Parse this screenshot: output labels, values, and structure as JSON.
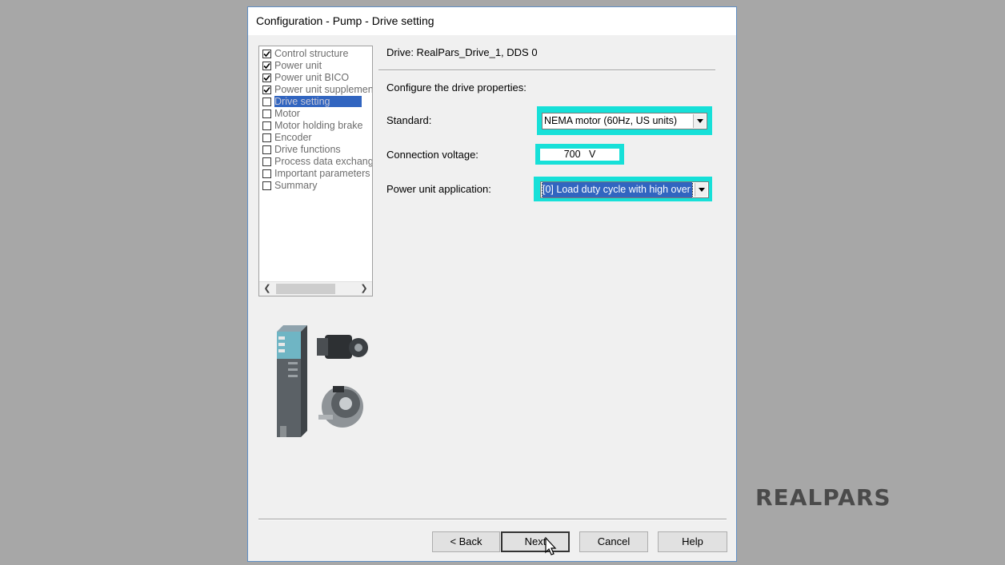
{
  "dialog": {
    "title": "Configuration - Pump - Drive setting"
  },
  "navigation": {
    "items": [
      {
        "label": "Control structure",
        "checked": true,
        "selected": false
      },
      {
        "label": "Power unit",
        "checked": true,
        "selected": false
      },
      {
        "label": "Power unit BICO",
        "checked": true,
        "selected": false
      },
      {
        "label": "Power unit supplement",
        "checked": true,
        "selected": false
      },
      {
        "label": "Drive setting",
        "checked": false,
        "selected": true
      },
      {
        "label": "Motor",
        "checked": false,
        "selected": false
      },
      {
        "label": "Motor holding brake",
        "checked": false,
        "selected": false
      },
      {
        "label": "Encoder",
        "checked": false,
        "selected": false
      },
      {
        "label": "Drive functions",
        "checked": false,
        "selected": false
      },
      {
        "label": "Process data exchang",
        "checked": false,
        "selected": false
      },
      {
        "label": "Important parameters",
        "checked": false,
        "selected": false
      },
      {
        "label": "Summary",
        "checked": false,
        "selected": false
      }
    ],
    "scroll_left_icon": "chevron-left-icon",
    "scroll_right_icon": "chevron-right-icon"
  },
  "main": {
    "drive_label": "Drive: RealPars_Drive_1, DDS 0",
    "configure_label": "Configure the drive properties:",
    "standard": {
      "label": "Standard:",
      "value": "NEMA motor (60Hz, US units)"
    },
    "connection_voltage": {
      "label": "Connection voltage:",
      "value": "700",
      "unit": "V"
    },
    "power_unit_application": {
      "label": "Power unit application:",
      "value": "[0] Load duty cycle with high over"
    }
  },
  "buttons": {
    "back": "< Back",
    "next": "Next",
    "cancel": "Cancel",
    "help": "Help"
  },
  "highlight_color": "#16e0d8",
  "brand": {
    "logo_text": "REALPARS"
  }
}
